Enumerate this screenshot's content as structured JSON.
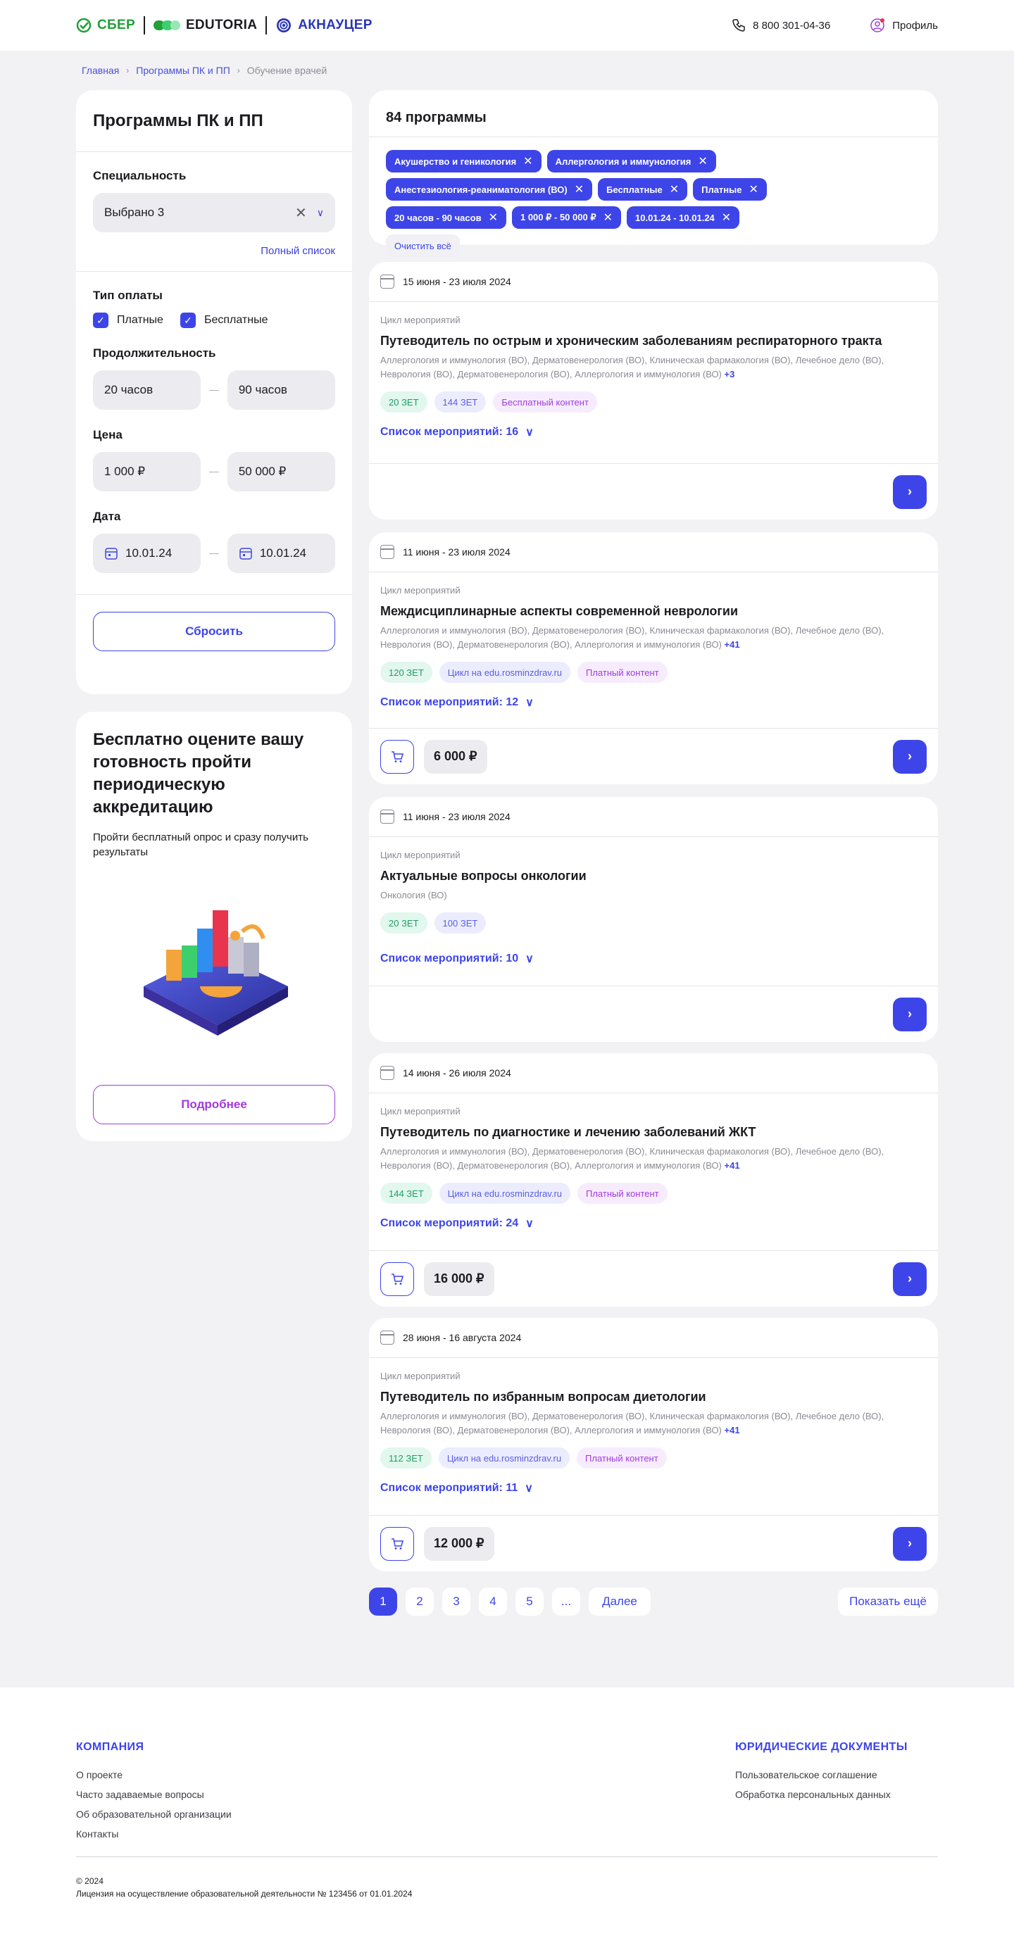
{
  "header": {
    "logo_sber": "СБЕР",
    "logo_edutoria": "EDUTORIA",
    "logo_akn": "АКНАУЦЕР",
    "phone": "8 800 301-04-36",
    "profile": "Профиль"
  },
  "breadcrumbs": [
    "Главная",
    "Программы ПК и ПП",
    "Обучение врачей"
  ],
  "filters": {
    "title": "Программы ПК и ПП",
    "specialty_label": "Специальность",
    "specialty_value": "Выбрано 3",
    "full_list": "Полный список",
    "payment_label": "Тип оплаты",
    "payment_paid": "Платные",
    "payment_free": "Бесплатные",
    "duration_label": "Продолжительность",
    "duration_from": "20 часов",
    "duration_to": "90 часов",
    "price_label": "Цена",
    "price_from": "1 000 ₽",
    "price_to": "50 000 ₽",
    "date_label": "Дата",
    "date_from": "10.01.24",
    "date_to": "10.01.24",
    "reset": "Сбросить"
  },
  "promo": {
    "title": "Бесплатно оцените вашу готовность пройти периодическую аккредитацию",
    "text": "Пройти бесплатный опрос и сразу получить результаты",
    "button": "Подробнее"
  },
  "summary": {
    "count": "84 программы",
    "chips": [
      "Акушерство и геникология",
      "Аллергология и иммунология",
      "Анестезиология-реаниматология (ВО)",
      "Бесплатные",
      "Платные",
      "20 часов - 90 часов",
      "1 000 ₽ - 50 000 ₽",
      "10.01.24 - 10.01.24"
    ],
    "clear_all": "Очистить всё"
  },
  "cards": [
    {
      "date": "15 июня - 23 июля 2024",
      "type": "Цикл мероприятий",
      "title": "Путеводитель по острым и хроническим заболеваниям респираторного тракта",
      "specs": "Аллергология и иммунология (ВО), Дерматовенерология (ВО), Клиническая фармакология (ВО), Лечебное дело (ВО), Неврология (ВО), Дерматовенерология (ВО), Аллергология и иммунология (ВО)",
      "more": "+3",
      "tag1": "20 ЗЕТ",
      "tag2": "144 ЗЕТ",
      "tag3": "Бесплатный контент",
      "events": "Список мероприятий: 16"
    },
    {
      "date": "11 июня - 23 июля 2024",
      "type": "Цикл мероприятий",
      "title": "Междисциплинарные аспекты современной неврологии",
      "specs": "Аллергология и иммунология (ВО), Дерматовенерология (ВО), Клиническая фармакология (ВО), Лечебное дело (ВО), Неврология (ВО), Дерматовенерология (ВО), Аллергология и иммунология (ВО)",
      "more": "+41",
      "tag1": "120 ЗЕТ",
      "tag2": "Цикл на edu.rosminzdrav.ru",
      "tag3": "Платный контент",
      "events": "Список мероприятий: 12",
      "price": "6 000 ₽"
    },
    {
      "date": "11 июня - 23 июля 2024",
      "type": "Цикл мероприятий",
      "title": "Актуальные вопросы онкологии",
      "specs": "Онкология (ВО)",
      "tag1": "20 ЗЕТ",
      "tag2": "100 ЗЕТ",
      "events": "Список мероприятий: 10"
    },
    {
      "date": "14 июня - 26 июля 2024",
      "type": "Цикл мероприятий",
      "title": "Путеводитель по диагностике и лечению заболеваний ЖКТ",
      "specs": "Аллергология и иммунология (ВО), Дерматовенерология (ВО), Клиническая фармакология (ВО), Лечебное дело (ВО), Неврология (ВО), Дерматовенерология (ВО), Аллергология и иммунология (ВО)",
      "more": "+41",
      "tag1": "144 ЗЕТ",
      "tag2": "Цикл на edu.rosminzdrav.ru",
      "tag3": "Платный контент",
      "events": "Список мероприятий: 24",
      "price": "16 000 ₽"
    },
    {
      "date": "28 июня - 16 августа 2024",
      "type": "Цикл мероприятий",
      "title": "Путеводитель по избранным вопросам диетологии",
      "specs": "Аллергология и иммунология (ВО), Дерматовенерология (ВО), Клиническая фармакология (ВО), Лечебное дело (ВО), Неврология (ВО), Дерматовенерология (ВО), Аллергология и иммунология (ВО)",
      "more": "+41",
      "tag1": "112 ЗЕТ",
      "tag2": "Цикл на edu.rosminzdrav.ru",
      "tag3": "Платный контент",
      "events": "Список мероприятий: 11",
      "price": "12 000 ₽"
    }
  ],
  "pagination": {
    "pages": [
      "1",
      "2",
      "3",
      "4",
      "5",
      "..."
    ],
    "next": "Далее",
    "show_more": "Показать ещё"
  },
  "footer": {
    "company_title": "КОМПАНИЯ",
    "company_links": [
      "О проекте",
      "Часто задаваемые вопросы",
      "Об образовательной организации",
      "Контакты"
    ],
    "legal_title": "ЮРИДИЧЕСКИЕ ДОКУМЕНТЫ",
    "legal_links": [
      "Пользовательское соглашение",
      "Обработка персональных данных"
    ],
    "copyright": "© 2024",
    "license": "Лицензия на осуществление образовательной деятельности № 123456 от 01.01.2024"
  },
  "colors": {
    "accent": "#3d45e8",
    "purple": "#a13bdc",
    "green": "#21a038"
  }
}
